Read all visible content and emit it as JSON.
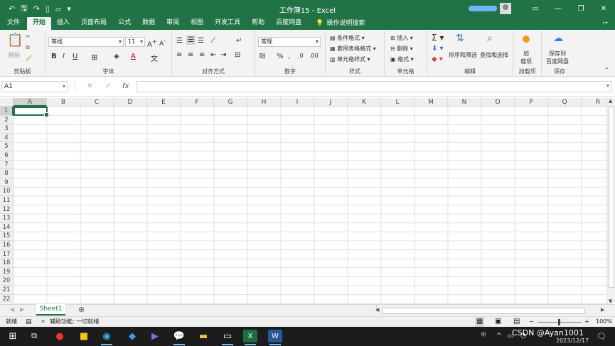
{
  "titlebar": {
    "title": "工作簿15 - Excel",
    "buttons": {
      "restore": "▭",
      "minimize": "—",
      "maximize": "❐",
      "close": "✕"
    }
  },
  "menu": {
    "tabs": [
      "文件",
      "开始",
      "插入",
      "页面布局",
      "公式",
      "数据",
      "审阅",
      "视图",
      "开发工具",
      "帮助",
      "百度网盘"
    ],
    "active_tab": "开始",
    "search_label": "操作说明搜索"
  },
  "ribbon": {
    "clipboard": {
      "paste": "粘贴",
      "label": "剪贴板"
    },
    "font": {
      "name": "等线",
      "size": "11",
      "label": "字体"
    },
    "alignment": {
      "label": "对齐方式"
    },
    "number": {
      "format": "常规",
      "label": "数字"
    },
    "styles": {
      "conditional": "条件格式",
      "table": "套用表格格式",
      "cell": "单元格样式",
      "label": "样式"
    },
    "cells": {
      "insert": "插入",
      "delete": "删除",
      "format": "格式",
      "label": "单元格"
    },
    "editing": {
      "sort": "排序和筛选",
      "find": "查找和选择",
      "label": "编辑"
    },
    "addins": {
      "add_line1": "加",
      "add_line2": "载项",
      "label": "加载项"
    },
    "save": {
      "line1": "保存到",
      "line2": "百度网盘",
      "label": "保存"
    }
  },
  "formula_bar": {
    "name_box": "A1",
    "fx": "fx",
    "value": ""
  },
  "grid": {
    "columns": [
      "A",
      "B",
      "C",
      "D",
      "E",
      "F",
      "G",
      "H",
      "I",
      "J",
      "K",
      "L",
      "M",
      "N",
      "O",
      "P",
      "Q",
      "R"
    ],
    "rows": [
      "1",
      "2",
      "3",
      "4",
      "5",
      "6",
      "7",
      "8",
      "9",
      "10",
      "11",
      "12",
      "13",
      "14",
      "15",
      "16",
      "17",
      "18",
      "19",
      "20",
      "21",
      "22"
    ],
    "selected_cell": "A1"
  },
  "sheet_tabs": {
    "sheets": [
      "Sheet1"
    ],
    "active": "Sheet1"
  },
  "status": {
    "ready": "就绪",
    "accessibility": "辅助功能: 一切就绪",
    "zoom": "100%"
  },
  "taskbar": {
    "date": "2023/12/17",
    "watermark": "CSDN @Ayan1001",
    "ime": "中"
  },
  "colors": {
    "accent": "#217346",
    "taskbar": "#1c1c1c"
  }
}
